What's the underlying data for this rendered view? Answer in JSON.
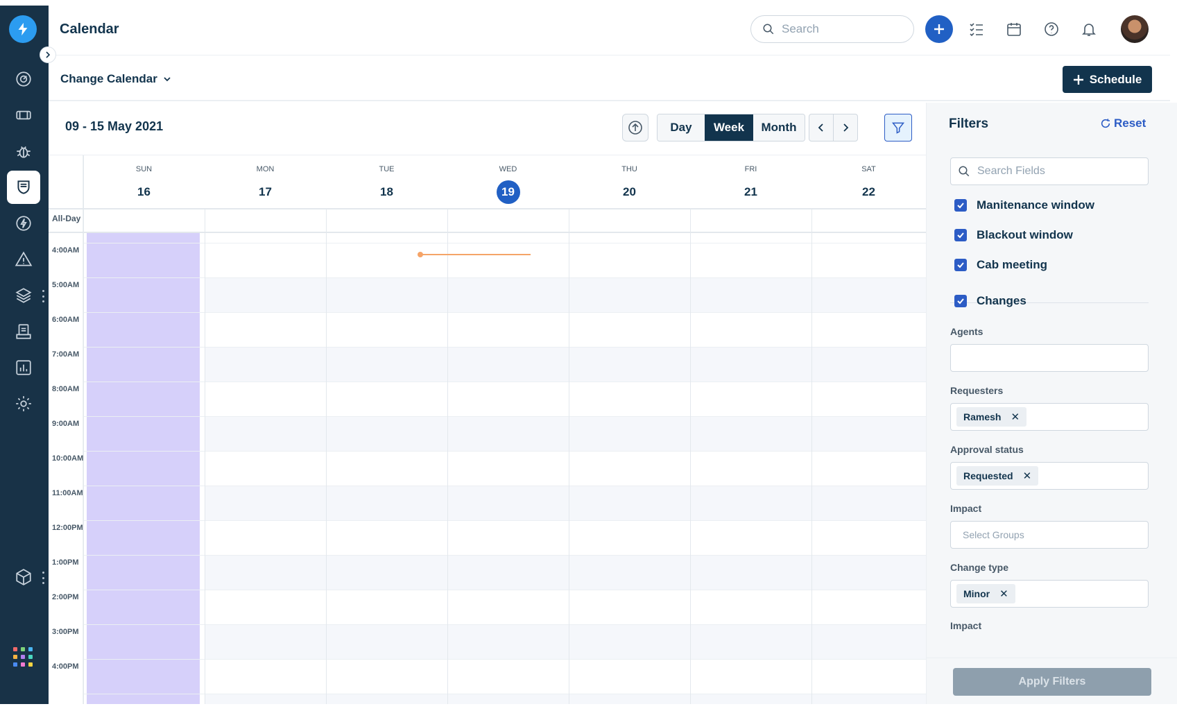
{
  "header": {
    "title": "Calendar",
    "search_placeholder": "Search"
  },
  "subheader": {
    "calendar_selector": "Change Calendar",
    "schedule_label": "Schedule"
  },
  "calendar": {
    "date_range": "09 - 15 May 2021",
    "view_tabs": [
      "Day",
      "Week",
      "Month"
    ],
    "active_view": "Week",
    "days": [
      {
        "dow": "SUN",
        "num": "16"
      },
      {
        "dow": "MON",
        "num": "17"
      },
      {
        "dow": "TUE",
        "num": "18"
      },
      {
        "dow": "WED",
        "num": "19"
      },
      {
        "dow": "THU",
        "num": "20"
      },
      {
        "dow": "FRI",
        "num": "21"
      },
      {
        "dow": "SAT",
        "num": "22"
      }
    ],
    "today": "19",
    "all_day_label": "All-Day",
    "hours": [
      "4:00AM",
      "5:00AM",
      "6:00AM",
      "7:00AM",
      "8:00AM",
      "9:00AM",
      "10:00AM",
      "11:00AM",
      "12:00PM",
      "1:00PM",
      "2:00PM",
      "3:00PM",
      "4:00PM"
    ]
  },
  "filters": {
    "title": "Filters",
    "reset_label": "Reset",
    "search_placeholder": "Search Fields",
    "checkboxes": [
      {
        "label": "Manitenance window",
        "checked": true
      },
      {
        "label": "Blackout window",
        "checked": true
      },
      {
        "label": "Cab meeting",
        "checked": true
      },
      {
        "label": "Changes",
        "checked": true
      }
    ],
    "agents_label": "Agents",
    "requesters_label": "Requesters",
    "requesters_chip": "Ramesh",
    "approval_label": "Approval status",
    "approval_chip": "Requested",
    "impact_label": "Impact",
    "impact_placeholder": "Select Groups",
    "change_type_label": "Change type",
    "change_type_chip": "Minor",
    "impact2_label": "Impact",
    "apply_label": "Apply Filters"
  },
  "colors": {
    "sidebar": "#183247",
    "accent": "#2160c4",
    "sunday_highlight": "#d6d0fa",
    "event": "#f5a468"
  }
}
